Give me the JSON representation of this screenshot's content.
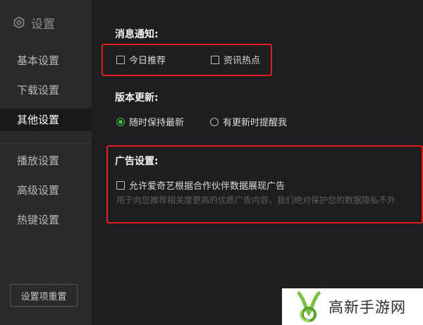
{
  "sidebar": {
    "title": "设置",
    "items": [
      {
        "label": "基本设置"
      },
      {
        "label": "下载设置"
      },
      {
        "label": "其他设置"
      },
      {
        "label": "播放设置"
      },
      {
        "label": "高级设置"
      },
      {
        "label": "热键设置"
      }
    ],
    "active_index": 2,
    "reset_label": "设置项重置"
  },
  "notifications": {
    "title": "消息通知:",
    "options": [
      {
        "label": "今日推荐",
        "checked": false
      },
      {
        "label": "资讯热点",
        "checked": false
      }
    ]
  },
  "update": {
    "title": "版本更新:",
    "options": [
      {
        "label": "随时保持最新",
        "selected": true
      },
      {
        "label": "有更新时提醒我",
        "selected": false
      }
    ]
  },
  "ads": {
    "title": "广告设置:",
    "option_label": "允许爱奇艺根据合作伙伴数据展现广告",
    "checked": false,
    "description": "用于向您推荐相关度更高的优质广告内容，我们绝对保护您的数据隐私不外"
  },
  "watermark": {
    "text": "高新手游网"
  },
  "colors": {
    "accent": "#3ec23e",
    "highlight_box": "#e01e1e",
    "sidebar_bg": "#2a2a2d",
    "main_bg": "#1e1e20"
  }
}
